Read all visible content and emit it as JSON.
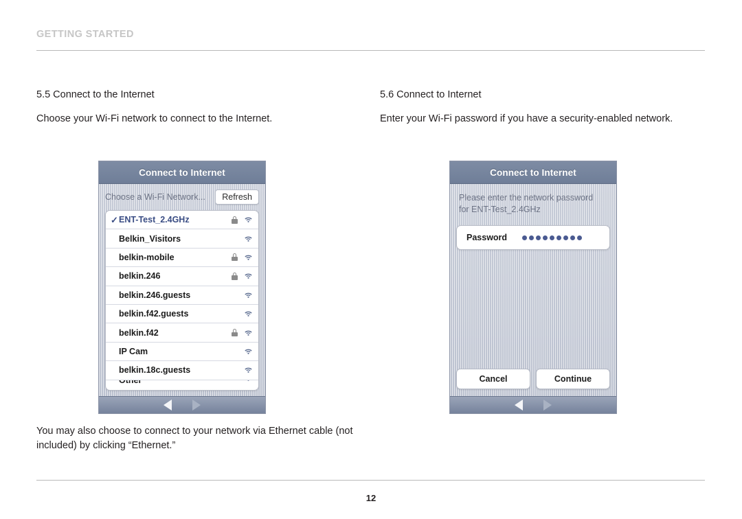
{
  "page": {
    "header": "GETTING STARTED",
    "number": "12"
  },
  "sections": {
    "left": {
      "title": "5.5 Connect to the Internet",
      "body": "Choose your Wi-Fi network to connect to the Internet."
    },
    "right": {
      "title": "5.6 Connect to Internet",
      "body": "Enter your Wi-Fi password if you have a security-enabled network."
    }
  },
  "footnote": "You may also choose to connect to your network via Ethernet cable (not included) by clicking “Ethernet.”",
  "device_left": {
    "header_title": "Connect to Internet",
    "chooser_label": "Choose a Wi-Fi Network...",
    "refresh_label": "Refresh",
    "networks": [
      {
        "name": "ENT-Test_2.4GHz",
        "selected": true,
        "locked": true,
        "wifi": true,
        "clipped": false
      },
      {
        "name": "Belkin_Visitors",
        "selected": false,
        "locked": false,
        "wifi": true,
        "clipped": false
      },
      {
        "name": "belkin-mobile",
        "selected": false,
        "locked": true,
        "wifi": true,
        "clipped": false
      },
      {
        "name": "belkin.246",
        "selected": false,
        "locked": true,
        "wifi": true,
        "clipped": false
      },
      {
        "name": "belkin.246.guests",
        "selected": false,
        "locked": false,
        "wifi": true,
        "clipped": false
      },
      {
        "name": "belkin.f42.guests",
        "selected": false,
        "locked": false,
        "wifi": true,
        "clipped": false
      },
      {
        "name": "belkin.f42",
        "selected": false,
        "locked": true,
        "wifi": true,
        "clipped": false
      },
      {
        "name": "IP Cam",
        "selected": false,
        "locked": false,
        "wifi": true,
        "clipped": false
      },
      {
        "name": "belkin.18c.guests",
        "selected": false,
        "locked": false,
        "wifi": true,
        "clipped": false
      },
      {
        "name": "Other",
        "selected": false,
        "locked": false,
        "wifi": true,
        "clipped": true
      }
    ],
    "nav": {
      "back_icon": "triangle-left-icon",
      "forward_icon": "triangle-right-icon"
    }
  },
  "device_right": {
    "header_title": "Connect to Internet",
    "prompt_line1": "Please enter the network password",
    "prompt_line2": "for ENT-Test_2.4GHz",
    "password_label": "Password",
    "password_dots": 9,
    "cancel_label": "Cancel",
    "continue_label": "Continue",
    "nav": {
      "back_icon": "triangle-left-icon",
      "forward_icon": "triangle-right-icon"
    }
  },
  "colors": {
    "header_bar": "#76839c",
    "device_body": "#cbd0da",
    "selected_text": "#3a4d84",
    "muted_text": "#6d7385",
    "section_header": "#c6c6c6"
  }
}
